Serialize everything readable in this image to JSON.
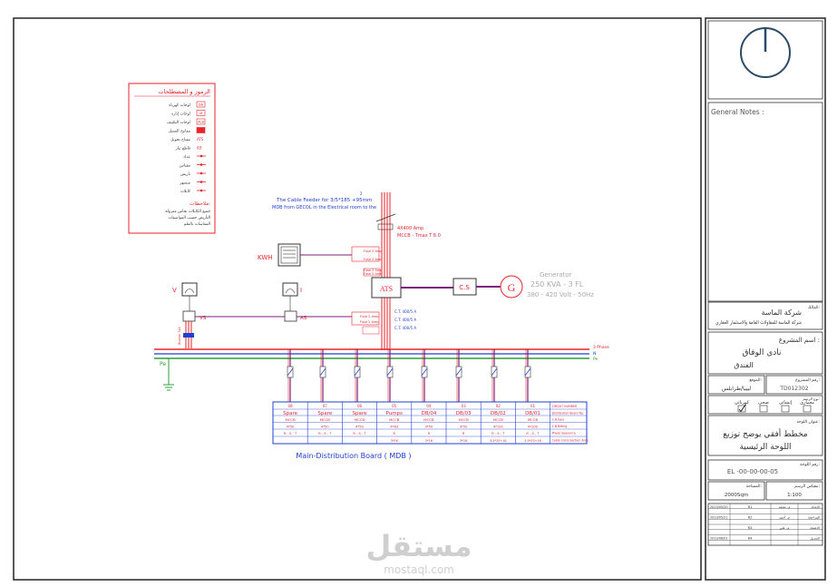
{
  "colors": {
    "red": "#e8232a",
    "blue": "#1f3fd0",
    "green": "#2e9e3a",
    "purple": "#7a1f7a",
    "frame": "#222222",
    "watermark": "#c7c7c7"
  },
  "legend": {
    "title": "الرموز و المصطلحات",
    "items": [
      "لوحات كهرباء",
      "لوحات إنارة",
      "لوحات التكييف",
      "مفاتيح الفصل",
      "مفتاح تحويل",
      "قاطع تيار",
      "عداد",
      "مقياس",
      "تأريض",
      "منصهر",
      "كابلات"
    ],
    "notes_title": "ملاحظات:",
    "notes": [
      "جميع الكابلات نحاس معزولة",
      "التأريض حسب المواصفات",
      "المقاسات بالملم"
    ],
    "symbol_labels": [
      "DB",
      "LB",
      "ACB",
      "",
      "ATS",
      "AS",
      "",
      "",
      "",
      "",
      "",
      "",
      ""
    ]
  },
  "diagram": {
    "cable_note_line1": "The Cable Feeder for  3/5*185 +95mm",
    "cable_note_sup": "2",
    "cable_note_line2": "MDB from GECOL in the Electrical room to the",
    "main_breaker_1": "4X400 Amp",
    "main_breaker_2": "MCCB - Tmax T 6.0",
    "kwh": "KWH",
    "fuse": "Fuse 2 Amp",
    "ats": "ATS",
    "cs": "C.S",
    "gen_symbol": "G",
    "gen_line1": "Generator",
    "gen_line2": "250 KVA - 3 FL",
    "gen_line3": "380 - 420 Volt - 50Hz",
    "v_label": "V",
    "vs_label": "VS",
    "a_label": "I",
    "as_label": "AS",
    "ct": "C.T. 400/5 A",
    "busbar_note": "Busbar 3ph",
    "pe": "Pe",
    "bus_labels": [
      "3 Phase",
      "N",
      "Pe"
    ],
    "mdb_title": "Main-Distribution Board ( MDB )"
  },
  "circuits": {
    "headers": [
      "Spare",
      "Spare",
      "Spare",
      "Pumps",
      "DB/04",
      "DB/03",
      "DB/02",
      "DB/01"
    ],
    "numbers": [
      "08",
      "07",
      "06",
      "05",
      "04",
      "03",
      "02",
      "01"
    ],
    "breaker": [
      "MCCB",
      "MCCB",
      "MCCB",
      "MCCB",
      "MCCB",
      "MCCB",
      "MCCB",
      "MCCB"
    ],
    "rating": [
      "4*50",
      "4*50",
      "4*50",
      "4*63",
      "3*50",
      "3*50",
      "4*100",
      "4*100"
    ],
    "phases": [
      "R - S - T",
      "R - S - T",
      "R - S - T",
      "R",
      "R",
      "R",
      "R - S - T",
      "R - S - T"
    ],
    "cable": [
      "",
      "",
      "",
      "3*16",
      "3*16",
      "3*16",
      "3.5*25+16",
      "3.5*25+16"
    ],
    "row_labels": [
      "CIRCUIT NUMBER",
      "Distribution Board No.",
      "C.B.type",
      "C.B.Rating",
      "Phase Sequence",
      "Cable Cross Section Area"
    ]
  },
  "title_block": {
    "general_notes": "General Notes :",
    "client_label": "المالك:",
    "client": "شركة الماسة للمقاولات العامة والاستثمار العقاري",
    "project_label": "اسم المشروع :",
    "project_line1": "نادي الوفاق",
    "project_line2": "الفندق",
    "location_label": "الموقع:",
    "location": "ليبيا/طرابلس",
    "project_no_label": "رقم المشروع:",
    "project_no": "TD012302",
    "discipline_label": "نوع الرسم:",
    "disciplines": [
      "معماري",
      "إنشائي",
      "صحي",
      "كهربائي"
    ],
    "drawing_title_label": "عنوان اللوحة:",
    "drawing_title_line1": "مخطط أفقي يوضح توزيع",
    "drawing_title_line2": "اللوحة الرئيسية",
    "drawing_no_label": "رقم اللوحة:",
    "drawing_no": "EL -00-00-00-05",
    "area_label": "المساحة:",
    "area": "2000Sqm",
    "scale_label": "مقياس الرسم:",
    "scale": "1:100",
    "rev_rows": [
      "الإعداد",
      "المراجعة",
      "الاعتماد",
      "التعديل"
    ],
    "rev_dates": [
      "2023/05/20",
      "2023/05/21",
      "",
      "2023/06/01"
    ],
    "rev_names": [
      "م. محمد",
      "م. أحمد",
      "م. علي",
      ""
    ],
    "rev_codes": [
      "R1",
      "R2",
      "R3",
      "R4"
    ]
  },
  "watermark": {
    "ar": "مستقل",
    "en": "mostaql.com"
  }
}
